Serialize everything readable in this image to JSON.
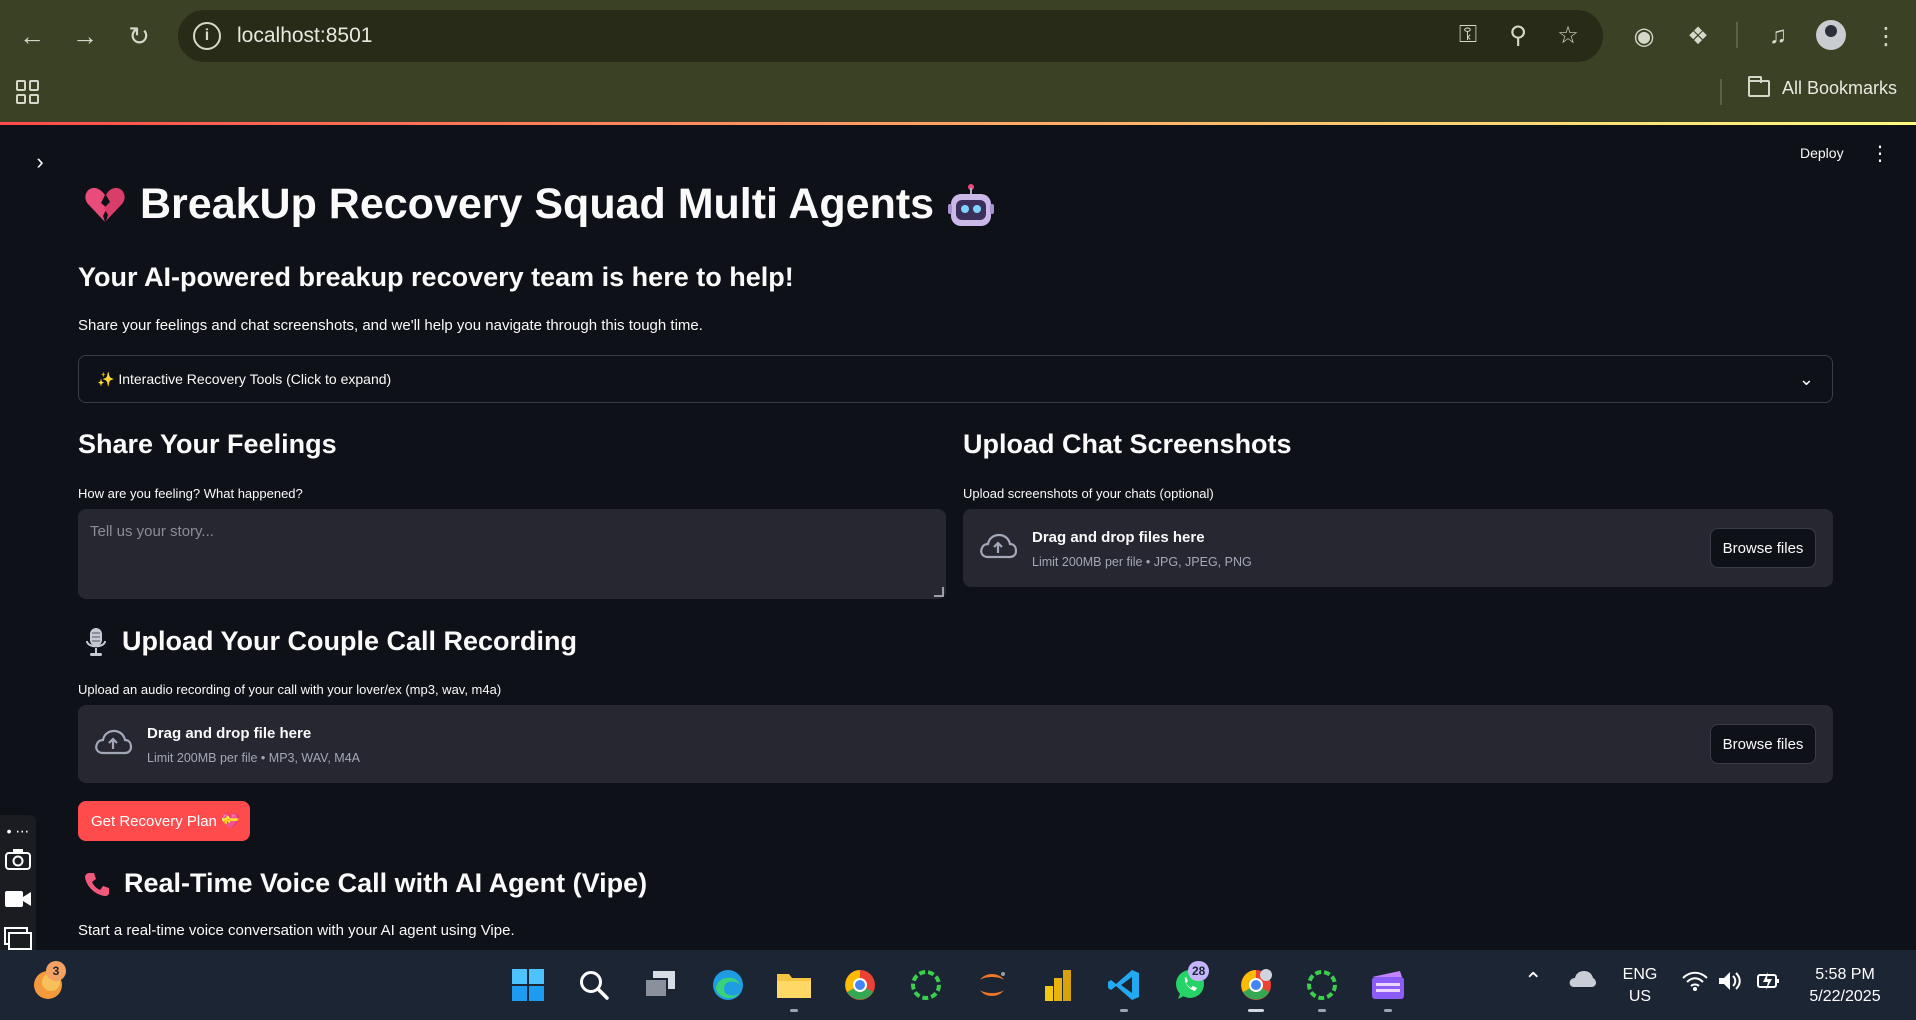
{
  "browser": {
    "url": "localhost:8501",
    "bookmarks_label": "All Bookmarks"
  },
  "app": {
    "deploy_label": "Deploy",
    "title": "BreakUp Recovery Squad Multi Agents",
    "subtitle": "Your AI-powered breakup recovery team is here to help!",
    "description": "Share your feelings and chat screenshots, and we'll help you navigate through this tough time.",
    "expander_label": "✨ Interactive Recovery Tools (Click to expand)",
    "feelings": {
      "heading": "Share Your Feelings",
      "label": "How are you feeling? What happened?",
      "placeholder": "Tell us your story..."
    },
    "screenshots": {
      "heading": "Upload Chat Screenshots",
      "label": "Upload screenshots of your chats (optional)",
      "drop_title": "Drag and drop files here",
      "drop_limit": "Limit 200MB per file • JPG, JPEG, PNG",
      "browse_label": "Browse files"
    },
    "recording": {
      "heading": "Upload Your Couple Call Recording",
      "label": "Upload an audio recording of your call with your lover/ex (mp3, wav, m4a)",
      "drop_title": "Drag and drop file here",
      "drop_limit": "Limit 200MB per file • MP3, WAV, M4A",
      "browse_label": "Browse files"
    },
    "primary_button": "Get Recovery Plan 💝",
    "voice": {
      "heading": "Real-Time Voice Call with AI Agent (Vipe)",
      "description": "Start a real-time voice conversation with your AI agent using Vipe."
    }
  },
  "taskbar": {
    "weather_badge": "3",
    "whatsapp_badge": "28",
    "language_line1": "ENG",
    "language_line2": "US",
    "time": "5:58 PM",
    "date": "5/22/2025"
  },
  "colors": {
    "accent": "#ff4b4b",
    "browser_frame": "#3b4125",
    "app_background": "#0e1117",
    "input_background": "#262730",
    "taskbar": "#1c2533"
  }
}
